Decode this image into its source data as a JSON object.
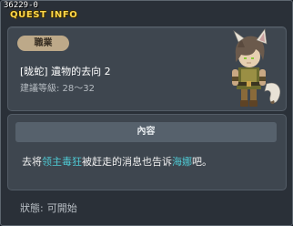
{
  "quest_id": "36229-0",
  "title": "QUEST INFO",
  "job_badge": "職業",
  "quest_name": "[昽蛇] 遺物的去向 2",
  "level_label": "建議等級: 28～32",
  "content_header": "內容",
  "content": {
    "pre": "去将",
    "highlight1": "领主毒狂",
    "mid": "被赶走的消息也告诉",
    "highlight2": "海娜",
    "post": "吧。"
  },
  "status": {
    "label": "狀態:",
    "value": "可開始"
  },
  "colors": {
    "title": "#ffd84a",
    "highlight": "#4fc8d2",
    "badge": "#bda989",
    "panel": "#3e464f"
  },
  "icons": {
    "character": "beast-eared-adventurer-sprite"
  }
}
